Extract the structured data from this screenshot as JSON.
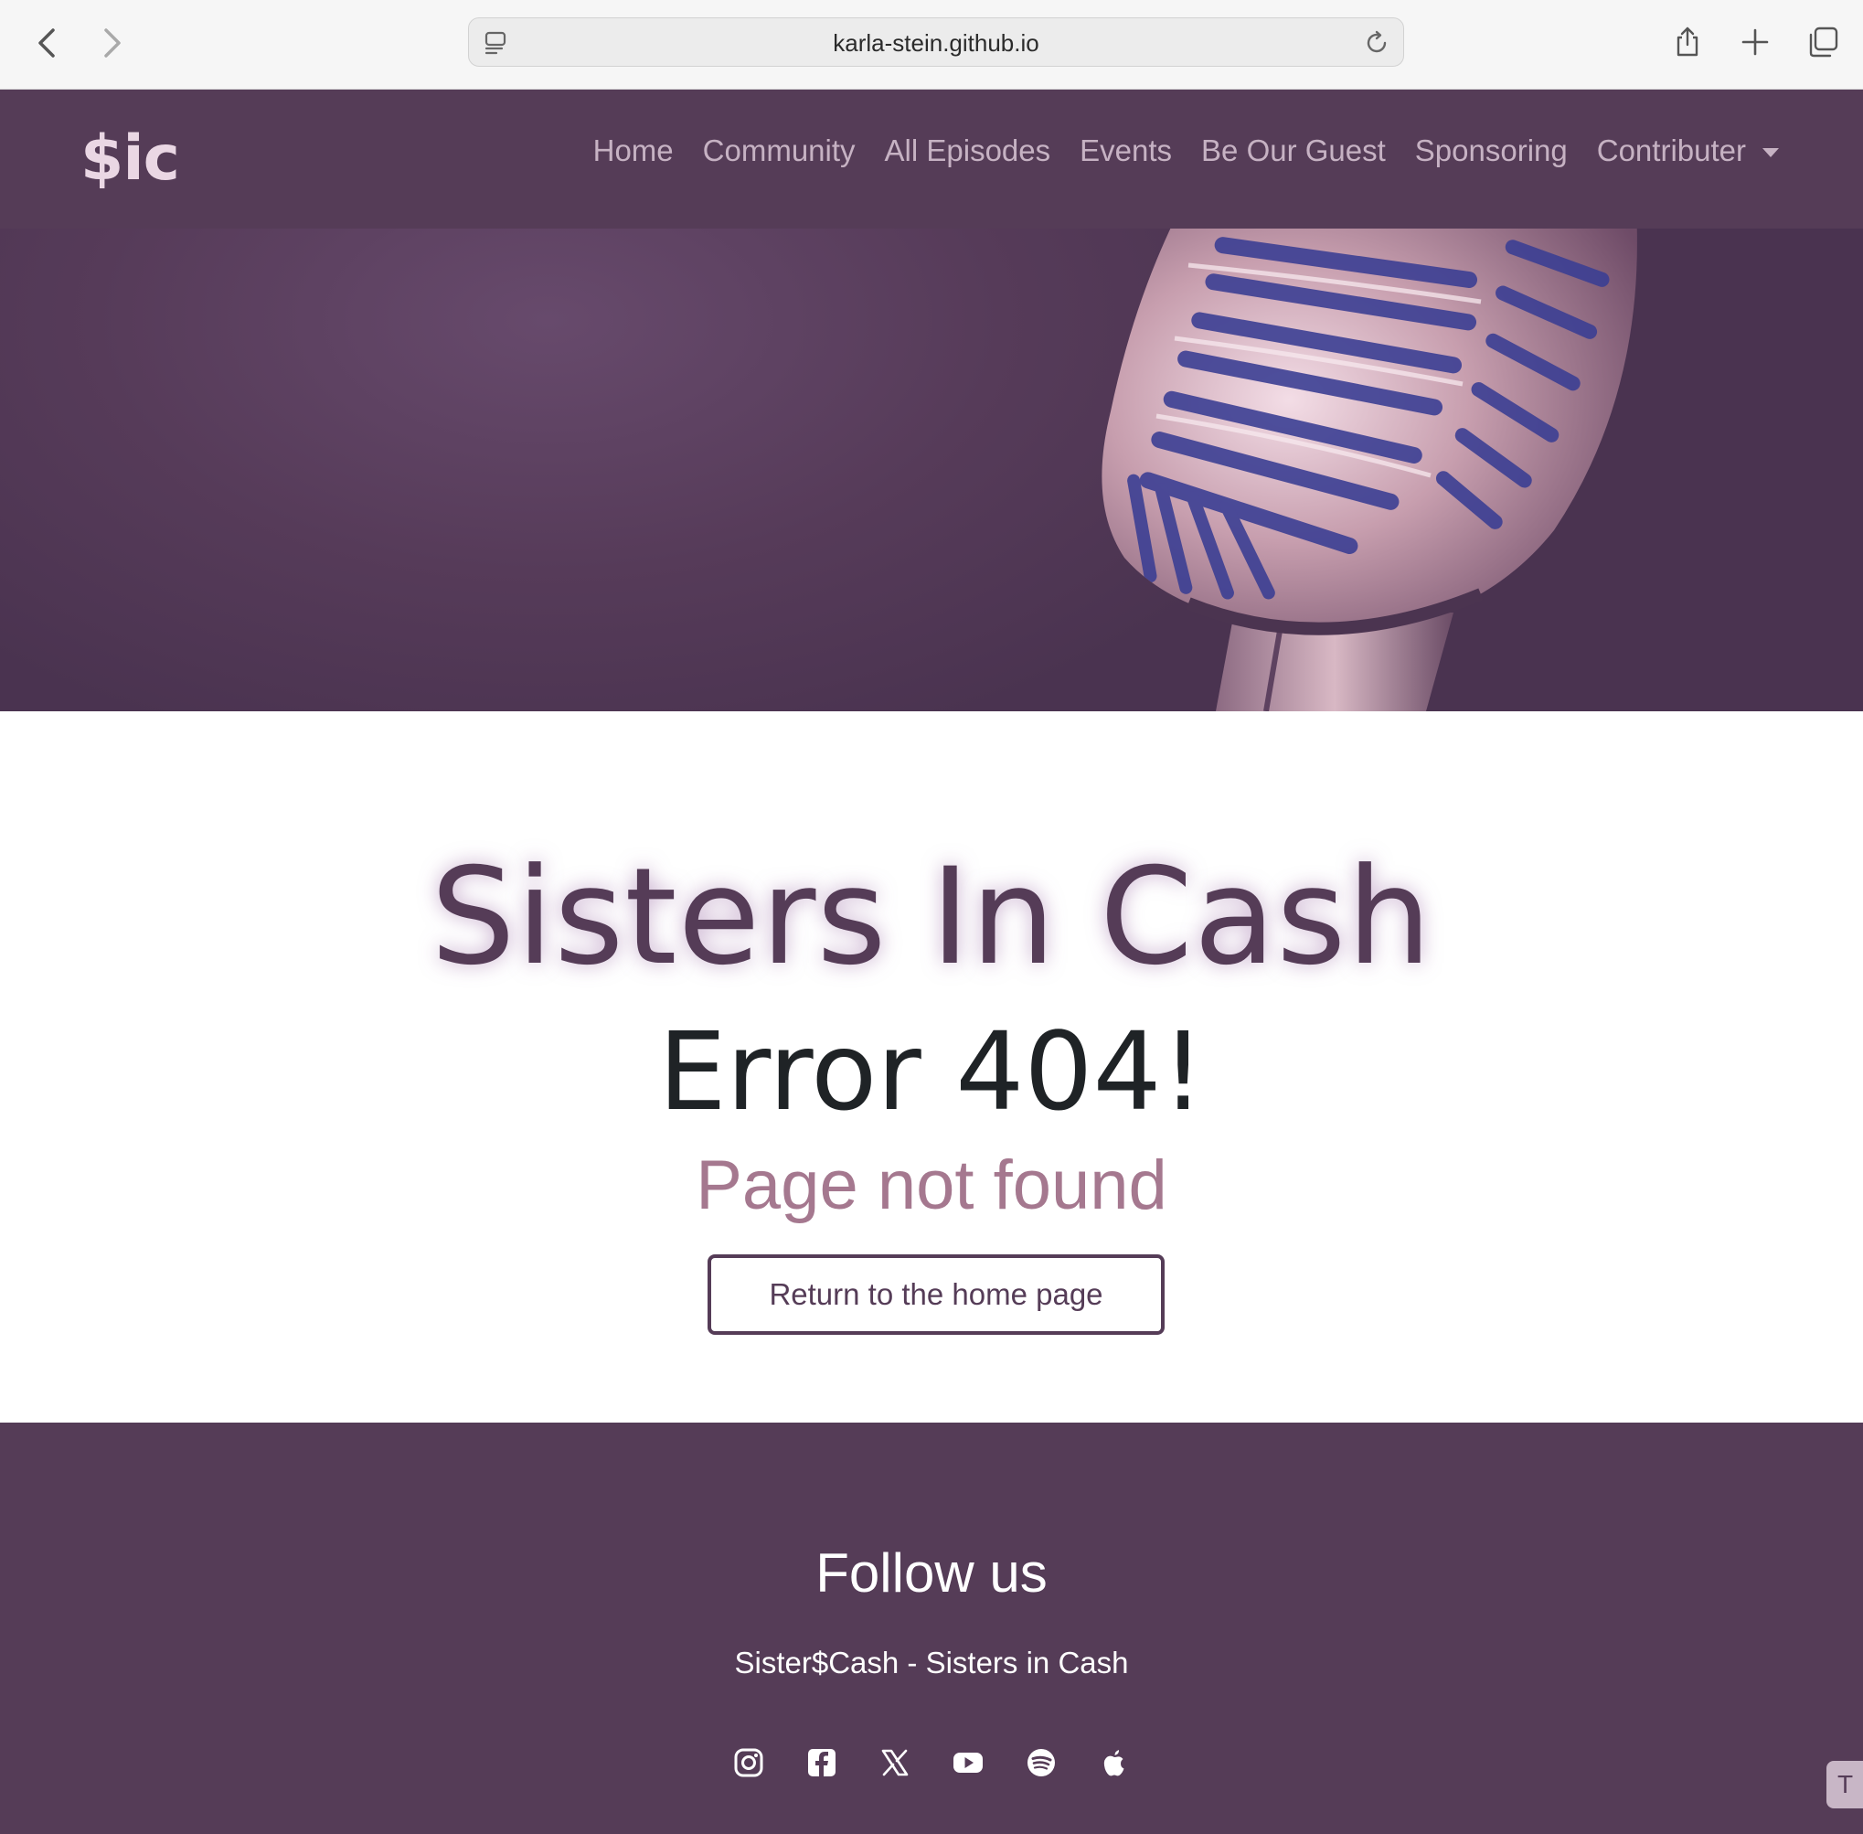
{
  "browser": {
    "url": "karla-stein.github.io",
    "icons": [
      "back-icon",
      "forward-icon",
      "page-icon",
      "reload-icon",
      "share-icon",
      "new-tab-icon",
      "tabs-overview-icon"
    ]
  },
  "navbar": {
    "brand": "$ic",
    "links": [
      "Home",
      "Community",
      "All Episodes",
      "Events",
      "Be Our Guest",
      "Sponsoring",
      "Contributer"
    ]
  },
  "main": {
    "title": "Sisters In Cash",
    "error": "Error 404!",
    "subtitle": "Page not found",
    "button_label": "Return to the home page"
  },
  "footer": {
    "heading": "Follow us",
    "tagline": "Sister$Cash - Sisters in Cash",
    "social_icons": [
      "instagram-icon",
      "facebook-icon",
      "x-icon",
      "youtube-icon",
      "spotify-icon",
      "apple-icon"
    ],
    "floating_tab_label": "T"
  },
  "colors": {
    "brand_purple": "#553c57",
    "accent_mauve": "#a5788f",
    "nav_text": "#c6b2c3",
    "brand_text": "#ead7e4"
  }
}
